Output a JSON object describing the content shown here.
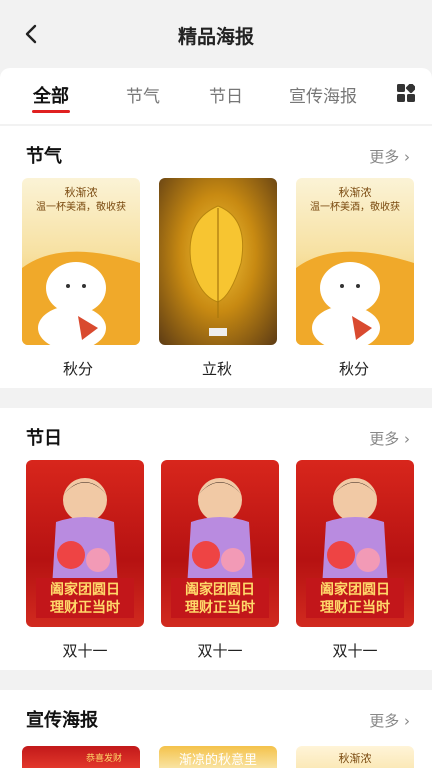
{
  "header": {
    "title": "精品海报"
  },
  "tabs": [
    {
      "label": "全部",
      "active": true
    },
    {
      "label": "节气",
      "active": false
    },
    {
      "label": "节日",
      "active": false
    },
    {
      "label": "宣传海报",
      "active": false
    }
  ],
  "icons": {
    "back": "chevron-left-icon",
    "tab_grid": "grid-icon",
    "more_arrow": "chevron-right-icon"
  },
  "colors": {
    "accent": "#e02020",
    "background": "#f2f2f2"
  },
  "sections": [
    {
      "title": "节气",
      "more": "更多 ›",
      "items": [
        {
          "label": "秋分",
          "poster_text": "秋渐浓\n温一杯美酒，敬收获"
        },
        {
          "label": "立秋"
        },
        {
          "label": "秋分",
          "poster_text": "秋渐浓\n温一杯美酒，敬收获"
        }
      ]
    },
    {
      "title": "节日",
      "more": "更多 ›",
      "items": [
        {
          "label": "双十一",
          "poster_text": "阖家团圆日\n理财正当时"
        },
        {
          "label": "双十一",
          "poster_text": "阖家团圆日\n理财正当时"
        },
        {
          "label": "双十一",
          "poster_text": "阖家团圆日\n理财正当时"
        }
      ]
    },
    {
      "title": "宣传海报",
      "more": "更多 ›",
      "items": [
        {
          "poster_text": "恭喜发财"
        },
        {
          "poster_text": "渐凉的秋意里"
        },
        {
          "poster_text": "秋渐浓"
        }
      ]
    }
  ]
}
